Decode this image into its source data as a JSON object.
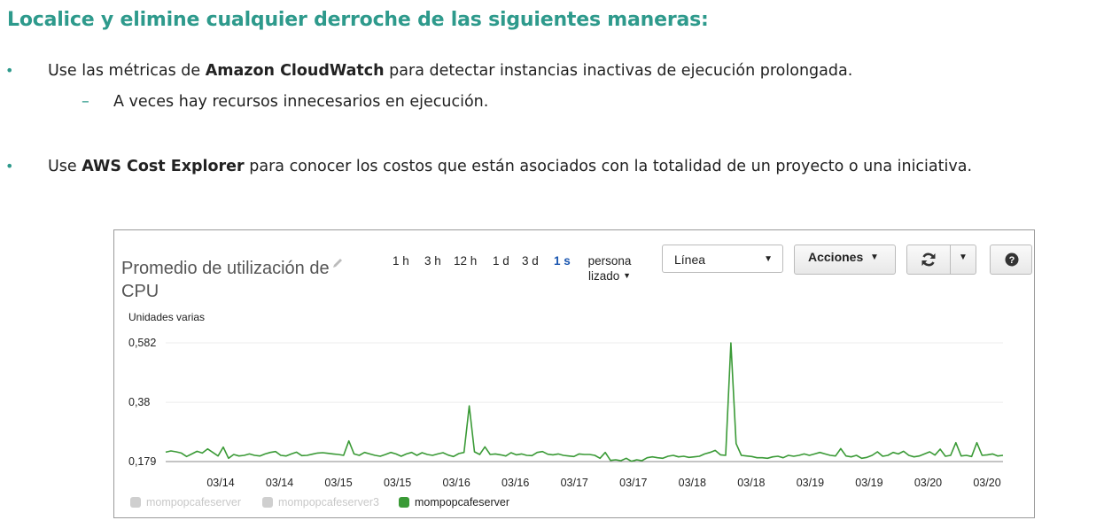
{
  "slide": {
    "title": "Localice y elimine cualquier derroche de las siguientes maneras:",
    "bullet1": {
      "prefix": "Use las métricas de ",
      "strong": "Amazon CloudWatch",
      "suffix": " para detectar instancias inactivas de ejecución prolongada."
    },
    "sub_bullet": "A veces hay recursos innecesarios en ejecución.",
    "bullet2": {
      "prefix": "Use ",
      "strong": "AWS Cost Explorer",
      "suffix": " para conocer los costos que están asociados con la totalidad de un proyecto o una iniciativa."
    },
    "dash": "–",
    "dot": "•"
  },
  "widget": {
    "title": "Promedio de utilización de CPU",
    "time_ranges": [
      "1 h",
      "3 h",
      "12 h",
      "1 d",
      "3 d",
      "1 s"
    ],
    "active_range": "1 s",
    "custom_label": "persona lizado",
    "stat_select": "Línea",
    "actions_label": "Acciones",
    "units": "Unidades varias",
    "icons": {
      "edit": "pencil-icon",
      "refresh": "refresh-icon",
      "dropdown": "chevron-down-icon",
      "help": "help-icon"
    }
  },
  "chart_data": {
    "type": "line",
    "title": "Promedio de utilización de CPU",
    "ylabel": "Unidades varias",
    "ylim": [
      0.179,
      0.582
    ],
    "yticks": [
      0.179,
      0.38,
      0.582
    ],
    "ytick_labels": [
      "0,179",
      "0,38",
      "0,582"
    ],
    "xtick_labels": [
      "03/14",
      "03/14",
      "03/15",
      "03/15",
      "03/16",
      "03/16",
      "03/17",
      "03/17",
      "03/18",
      "03/18",
      "03/19",
      "03/19",
      "03/20",
      "03/20"
    ],
    "grid": true,
    "legend_position": "bottom-left",
    "series": [
      {
        "name": "mompopcafeserver",
        "color": "#cfcfcf",
        "visible": false,
        "values": []
      },
      {
        "name": "mompopcafeserver3",
        "color": "#cfcfcf",
        "visible": false,
        "values": []
      },
      {
        "name": "mompopcafeserver",
        "color": "#3a9a36",
        "visible": true,
        "values": [
          0.211,
          0.215,
          0.212,
          0.208,
          0.196,
          0.205,
          0.214,
          0.208,
          0.222,
          0.21,
          0.198,
          0.228,
          0.19,
          0.203,
          0.198,
          0.2,
          0.205,
          0.2,
          0.198,
          0.205,
          0.21,
          0.213,
          0.2,
          0.198,
          0.205,
          0.211,
          0.199,
          0.2,
          0.204,
          0.208,
          0.209,
          0.207,
          0.205,
          0.203,
          0.2,
          0.249,
          0.205,
          0.2,
          0.21,
          0.205,
          0.2,
          0.197,
          0.203,
          0.21,
          0.205,
          0.197,
          0.205,
          0.21,
          0.2,
          0.209,
          0.203,
          0.2,
          0.205,
          0.209,
          0.201,
          0.196,
          0.206,
          0.21,
          0.368,
          0.212,
          0.203,
          0.229,
          0.203,
          0.205,
          0.202,
          0.198,
          0.209,
          0.202,
          0.205,
          0.2,
          0.199,
          0.21,
          0.213,
          0.204,
          0.202,
          0.205,
          0.2,
          0.198,
          0.196,
          0.205,
          0.203,
          0.203,
          0.2,
          0.19,
          0.21,
          0.183,
          0.185,
          0.182,
          0.19,
          0.18,
          0.185,
          0.182,
          0.192,
          0.195,
          0.192,
          0.19,
          0.197,
          0.2,
          0.195,
          0.197,
          0.193,
          0.195,
          0.197,
          0.205,
          0.21,
          0.217,
          0.202,
          0.2,
          0.582,
          0.24,
          0.2,
          0.198,
          0.196,
          0.192,
          0.192,
          0.19,
          0.195,
          0.197,
          0.192,
          0.2,
          0.197,
          0.2,
          0.205,
          0.2,
          0.205,
          0.21,
          0.205,
          0.2,
          0.198,
          0.223,
          0.198,
          0.195,
          0.2,
          0.19,
          0.193,
          0.2,
          0.212,
          0.197,
          0.2,
          0.21,
          0.205,
          0.214,
          0.2,
          0.195,
          0.198,
          0.205,
          0.212,
          0.201,
          0.221,
          0.197,
          0.2,
          0.243,
          0.198,
          0.2,
          0.196,
          0.243,
          0.2,
          0.202,
          0.205,
          0.198,
          0.2
        ]
      }
    ]
  }
}
